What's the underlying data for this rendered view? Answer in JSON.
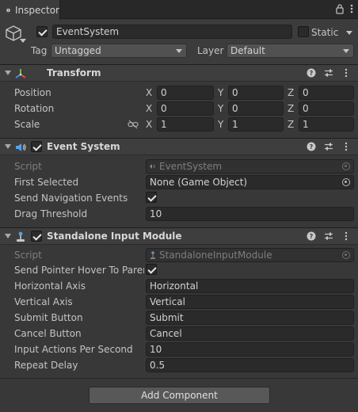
{
  "tab": {
    "title": "Inspector"
  },
  "object": {
    "name": "EventSystem",
    "static_label": "Static",
    "tag_label": "Tag",
    "tag_value": "Untagged",
    "layer_label": "Layer",
    "layer_value": "Default"
  },
  "transform": {
    "title": "Transform",
    "position_label": "Position",
    "rotation_label": "Rotation",
    "scale_label": "Scale",
    "axis_x": "X",
    "axis_y": "Y",
    "axis_z": "Z",
    "position": [
      "0",
      "0",
      "0"
    ],
    "rotation": [
      "0",
      "0",
      "0"
    ],
    "scale": [
      "1",
      "1",
      "1"
    ]
  },
  "event_system": {
    "title": "Event System",
    "script_label": "Script",
    "script_value": "EventSystem",
    "first_selected_label": "First Selected",
    "first_selected_value": "None (Game Object)",
    "send_nav_label": "Send Navigation Events",
    "drag_threshold_label": "Drag Threshold",
    "drag_threshold_value": "10"
  },
  "input_module": {
    "title": "Standalone Input Module",
    "script_label": "Script",
    "script_value": "StandaloneInputModule",
    "hover_label": "Send Pointer Hover To Parent",
    "horizontal_label": "Horizontal Axis",
    "horizontal_value": "Horizontal",
    "vertical_label": "Vertical Axis",
    "vertical_value": "Vertical",
    "submit_label": "Submit Button",
    "submit_value": "Submit",
    "cancel_label": "Cancel Button",
    "cancel_value": "Cancel",
    "ips_label": "Input Actions Per Second",
    "ips_value": "10",
    "repeat_label": "Repeat Delay",
    "repeat_value": "0.5"
  },
  "footer": {
    "add_component": "Add Component"
  }
}
